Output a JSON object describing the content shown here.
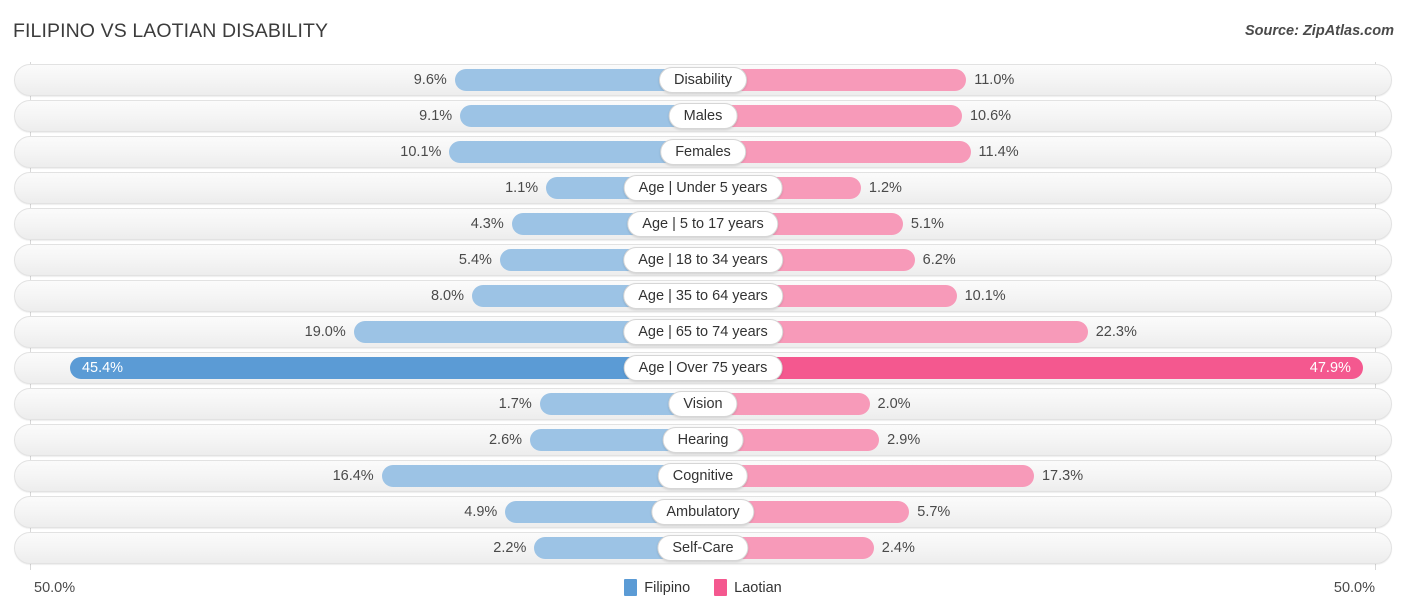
{
  "header": {
    "title": "FILIPINO VS LAOTIAN DISABILITY",
    "source": "Source: ZipAtlas.com"
  },
  "legend": {
    "items": [
      {
        "label": "Filipino",
        "color": "#5b9bd5"
      },
      {
        "label": "Laotian",
        "color": "#f4588f"
      }
    ]
  },
  "axis": {
    "left_label": "50.0%",
    "right_label": "50.0%",
    "max": 50.0
  },
  "colors": {
    "left_bar": "#9cc3e5",
    "right_bar": "#f79ab9",
    "left_bar_highlight": "#5b9bd5",
    "right_bar_highlight": "#f4588f",
    "track": "#f4f4f4",
    "text": "#4a4a4a"
  },
  "chart_data": {
    "type": "bar",
    "orientation": "horizontal-diverging",
    "title": "FILIPINO VS LAOTIAN DISABILITY",
    "xlabel": "",
    "ylabel": "",
    "xlim": [
      -50.0,
      50.0
    ],
    "grid": true,
    "legend_position": "bottom-center",
    "series": [
      {
        "name": "Filipino",
        "side": "left",
        "color": "#9cc3e5",
        "values": [
          9.6,
          9.1,
          10.1,
          1.1,
          4.3,
          5.4,
          8.0,
          19.0,
          45.4,
          1.7,
          2.6,
          16.4,
          4.9,
          2.2
        ]
      },
      {
        "name": "Laotian",
        "side": "right",
        "color": "#f79ab9",
        "values": [
          11.0,
          10.6,
          11.4,
          1.2,
          5.1,
          6.2,
          10.1,
          22.3,
          47.9,
          2.0,
          2.9,
          17.3,
          5.7,
          2.4
        ]
      }
    ],
    "categories": [
      "Disability",
      "Males",
      "Females",
      "Age | Under 5 years",
      "Age | 5 to 17 years",
      "Age | 18 to 34 years",
      "Age | 35 to 64 years",
      "Age | 65 to 74 years",
      "Age | Over 75 years",
      "Vision",
      "Hearing",
      "Cognitive",
      "Ambulatory",
      "Self-Care"
    ]
  },
  "rows": [
    {
      "label": "Disability",
      "left": "9.6%",
      "right": "11.0%",
      "left_value": 9.6,
      "right_value": 11.0,
      "highlight": false
    },
    {
      "label": "Males",
      "left": "9.1%",
      "right": "10.6%",
      "left_value": 9.1,
      "right_value": 10.6,
      "highlight": false
    },
    {
      "label": "Females",
      "left": "10.1%",
      "right": "11.4%",
      "left_value": 10.1,
      "right_value": 11.4,
      "highlight": false
    },
    {
      "label": "Age | Under 5 years",
      "left": "1.1%",
      "right": "1.2%",
      "left_value": 1.1,
      "right_value": 1.2,
      "highlight": false
    },
    {
      "label": "Age | 5 to 17 years",
      "left": "4.3%",
      "right": "5.1%",
      "left_value": 4.3,
      "right_value": 5.1,
      "highlight": false
    },
    {
      "label": "Age | 18 to 34 years",
      "left": "5.4%",
      "right": "6.2%",
      "left_value": 5.4,
      "right_value": 6.2,
      "highlight": false
    },
    {
      "label": "Age | 35 to 64 years",
      "left": "8.0%",
      "right": "10.1%",
      "left_value": 8.0,
      "right_value": 10.1,
      "highlight": false
    },
    {
      "label": "Age | 65 to 74 years",
      "left": "19.0%",
      "right": "22.3%",
      "left_value": 19.0,
      "right_value": 22.3,
      "highlight": false
    },
    {
      "label": "Age | Over 75 years",
      "left": "45.4%",
      "right": "47.9%",
      "left_value": 45.4,
      "right_value": 47.9,
      "highlight": true
    },
    {
      "label": "Vision",
      "left": "1.7%",
      "right": "2.0%",
      "left_value": 1.7,
      "right_value": 2.0,
      "highlight": false
    },
    {
      "label": "Hearing",
      "left": "2.6%",
      "right": "2.9%",
      "left_value": 2.6,
      "right_value": 2.9,
      "highlight": false
    },
    {
      "label": "Cognitive",
      "left": "16.4%",
      "right": "17.3%",
      "left_value": 16.4,
      "right_value": 17.3,
      "highlight": false
    },
    {
      "label": "Ambulatory",
      "left": "4.9%",
      "right": "5.7%",
      "left_value": 4.9,
      "right_value": 5.7,
      "highlight": false
    },
    {
      "label": "Self-Care",
      "left": "2.2%",
      "right": "2.4%",
      "left_value": 2.2,
      "right_value": 2.4,
      "highlight": false
    }
  ]
}
